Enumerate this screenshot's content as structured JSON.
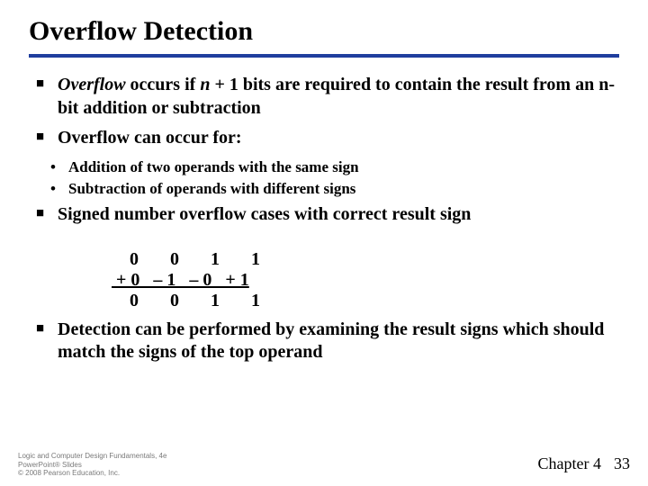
{
  "title": "Overflow Detection",
  "bullets": {
    "b1_before": "Overflow",
    "b1_after": " occurs if ",
    "b1_var": "n",
    "b1_tail": " + 1 bits are required to contain the result from an n-bit addition or subtraction",
    "b2": "Overflow can occur for:",
    "b3": "Signed number overflow cases with correct result sign",
    "b4": "Detection can be performed by examining the result signs which should match the signs of the top operand"
  },
  "sub": {
    "s1": "Addition of two operands with the same sign",
    "s2": "Subtraction of operands with different signs"
  },
  "cases": {
    "row1": "    0       0       1       1",
    "row2": " + 0   – 1   – 0   + 1",
    "row3": "    0       0       1       1"
  },
  "footer": {
    "line1": "Logic and Computer Design Fundamentals, 4e",
    "line2": "PowerPoint® Slides",
    "line3": "© 2008 Pearson Education, Inc.",
    "chapter": "Chapter 4",
    "page": "33"
  }
}
